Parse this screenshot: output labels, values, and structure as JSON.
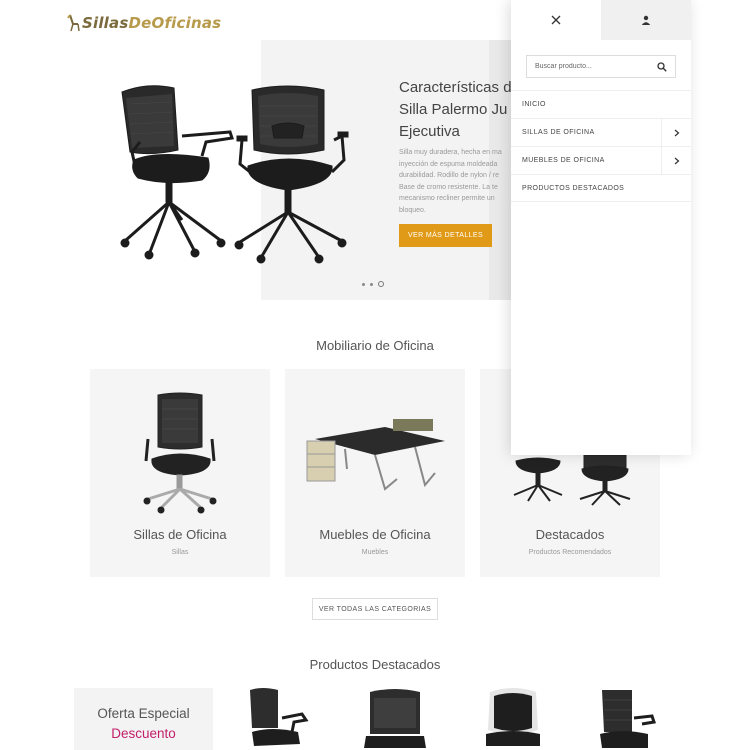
{
  "header": {
    "logo": {
      "part1": "Sillas",
      "part2": "DeOficinas"
    }
  },
  "hero": {
    "title_lines": [
      "Características d",
      "Silla Palermo Ju",
      "Ejecutiva"
    ],
    "description_lines": [
      "Silla muy duradera, hecha en ma",
      "inyección de espuma moldeada",
      "durabilidad. Rodillo de nylon / re",
      "Base de cromo resistente. La te",
      "mecanismo recliner permite un",
      "bloqueo."
    ],
    "button_label": "VER MÁS DETALLES",
    "slides": {
      "count": 3,
      "active": 3
    }
  },
  "categories": {
    "title": "Mobiliario de Oficina",
    "items": [
      {
        "title": "Sillas de Oficina",
        "subtitle": "Sillas"
      },
      {
        "title": "Muebles de Oficina",
        "subtitle": "Muebles"
      },
      {
        "title": "Destacados",
        "subtitle": "Productos Recomendados"
      }
    ],
    "view_all_label": "VER TODAS LAS CATEGORIAS"
  },
  "featured": {
    "title": "Productos Destacados",
    "offer": {
      "title": "Oferta Especial",
      "subtitle": "Descuento"
    }
  },
  "side_panel": {
    "tabs": [
      {
        "icon": "close-icon"
      },
      {
        "icon": "user-icon"
      }
    ],
    "search": {
      "placeholder": "Buscar producto...",
      "value": "",
      "icon": "search-icon"
    },
    "menu": [
      {
        "label": "INICIO",
        "has_submenu": false
      },
      {
        "label": "SILLAS DE OFICINA",
        "has_submenu": true
      },
      {
        "label": "MUEBLES DE OFICINA",
        "has_submenu": true
      },
      {
        "label": "PRODUCTOS DESTACADOS",
        "has_submenu": false
      }
    ]
  },
  "colors": {
    "accent_button": "#e09a17",
    "discount_text": "#c2206b",
    "logo_dark": "#7a6a3c",
    "logo_gold": "#b79a4b"
  }
}
